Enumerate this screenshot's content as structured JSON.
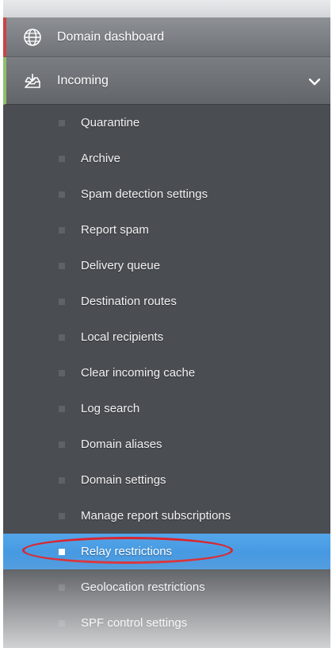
{
  "nav": {
    "dashboard": {
      "label": "Domain dashboard",
      "icon": "globe-icon"
    },
    "incoming": {
      "label": "Incoming",
      "icon": "inbox-download-icon",
      "expanded": true
    },
    "submenu": [
      {
        "label": "Quarantine"
      },
      {
        "label": "Archive"
      },
      {
        "label": "Spam detection settings"
      },
      {
        "label": "Report spam"
      },
      {
        "label": "Delivery queue"
      },
      {
        "label": "Destination routes"
      },
      {
        "label": "Local recipients"
      },
      {
        "label": "Clear incoming cache"
      },
      {
        "label": "Log search"
      },
      {
        "label": "Domain aliases"
      },
      {
        "label": "Domain settings"
      },
      {
        "label": "Manage report subscriptions"
      },
      {
        "label": "Relay restrictions",
        "active": true
      },
      {
        "label": "Geolocation restrictions"
      },
      {
        "label": "SPF control settings"
      }
    ]
  },
  "colors": {
    "panel_bg": "#4a4d52",
    "active_bg": "#3b8fda",
    "annotation": "#d9262e",
    "dashboard_accent": "#c9434a",
    "incoming_accent": "#8fbf6a"
  }
}
